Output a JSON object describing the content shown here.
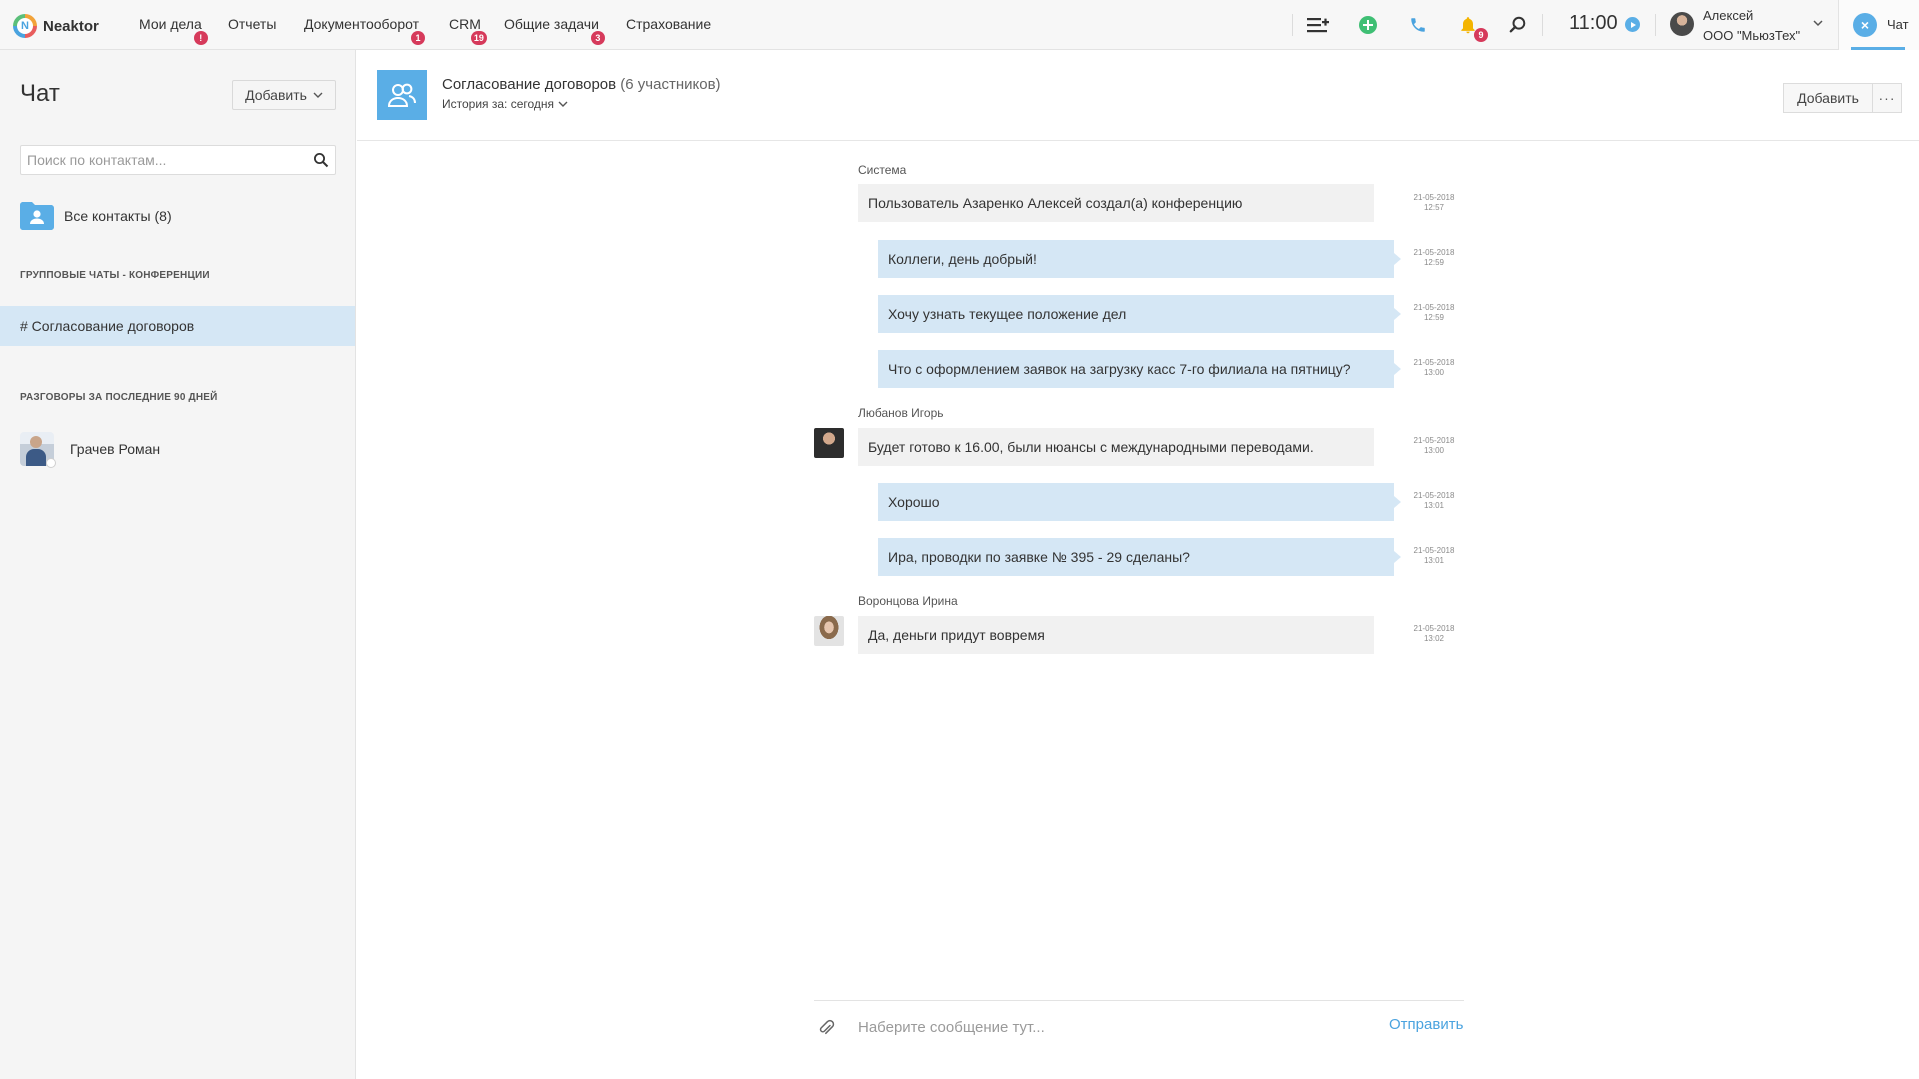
{
  "app": {
    "brand_logo_letter": "N",
    "brand_name": "Neaktor"
  },
  "nav": {
    "items": [
      {
        "label": "Мои дела",
        "badge": "!"
      },
      {
        "label": "Отчеты",
        "badge": ""
      },
      {
        "label": "Документооборот",
        "badge": "1"
      },
      {
        "label": "CRM",
        "badge": "19"
      },
      {
        "label": "Общие задачи",
        "badge": "3"
      },
      {
        "label": "Страхование",
        "badge": ""
      }
    ],
    "notifications_badge": "9",
    "time": "11:00",
    "user_name": "Алексей",
    "user_org": "ООО \"МьюзТех\"",
    "chat_tab_label": "Чат",
    "chat_tab_icon": "close-x",
    "icons": [
      "add-list-icon",
      "plus-circle-icon",
      "phone-icon",
      "bell-icon",
      "search-icon",
      "play-icon"
    ],
    "colors": {
      "accent": "#5aaee6",
      "badge": "#d63a5b",
      "add": "#3fbf74",
      "bell": "#f4b400"
    }
  },
  "sidebar": {
    "title": "Чат",
    "add_label": "Добавить",
    "search_placeholder": "Поиск по контактам...",
    "all_contacts_label": "Все контакты (8)",
    "group_section_title": "ГРУППОВЫЕ ЧАТЫ - КОНФЕРЕНЦИИ",
    "group_chats": [
      {
        "label": "# Согласование договоров",
        "selected": true
      }
    ],
    "recent_section_title": "РАЗГОВОРЫ ЗА ПОСЛЕДНИЕ 90 ДНЕЙ",
    "recent_contacts": [
      {
        "name": "Грачев Роман"
      }
    ]
  },
  "chat": {
    "title": "Согласование договоров",
    "participants": "(6 участников)",
    "history_label": "История за: сегодня",
    "add_label": "Добавить",
    "more_label": "···",
    "groups": [
      {
        "sender": "Система"
      },
      {
        "sender": "Любанов Игорь"
      },
      {
        "sender": "Воронцова Ирина"
      }
    ],
    "messages": [
      {
        "text": "Пользователь Азаренко Алексей создал(а) конференцию",
        "date": "21-05-2018",
        "time": "12:57",
        "dir": "in"
      },
      {
        "text": "Коллеги, день добрый!",
        "date": "21-05-2018",
        "time": "12:59",
        "dir": "out"
      },
      {
        "text": "Хочу узнать текущее положение дел",
        "date": "21-05-2018",
        "time": "12:59",
        "dir": "out"
      },
      {
        "text": "Что с оформлением заявок на загрузку касс 7-го филиала на пятницу?",
        "date": "21-05-2018",
        "time": "13:00",
        "dir": "out"
      },
      {
        "text": "Будет готово к 16.00, были нюансы с международными переводами.",
        "date": "21-05-2018",
        "time": "13:00",
        "dir": "in"
      },
      {
        "text": "Хорошо",
        "date": "21-05-2018",
        "time": "13:01",
        "dir": "out"
      },
      {
        "text": "Ира, проводки по заявке № 395 - 29 сделаны?",
        "date": "21-05-2018",
        "time": "13:01",
        "dir": "out"
      },
      {
        "text": "Да, деньги придут вовремя",
        "date": "21-05-2018",
        "time": "13:02",
        "dir": "in"
      }
    ],
    "composer_placeholder": "Наберите сообщение тут...",
    "send_label": "Отправить"
  }
}
